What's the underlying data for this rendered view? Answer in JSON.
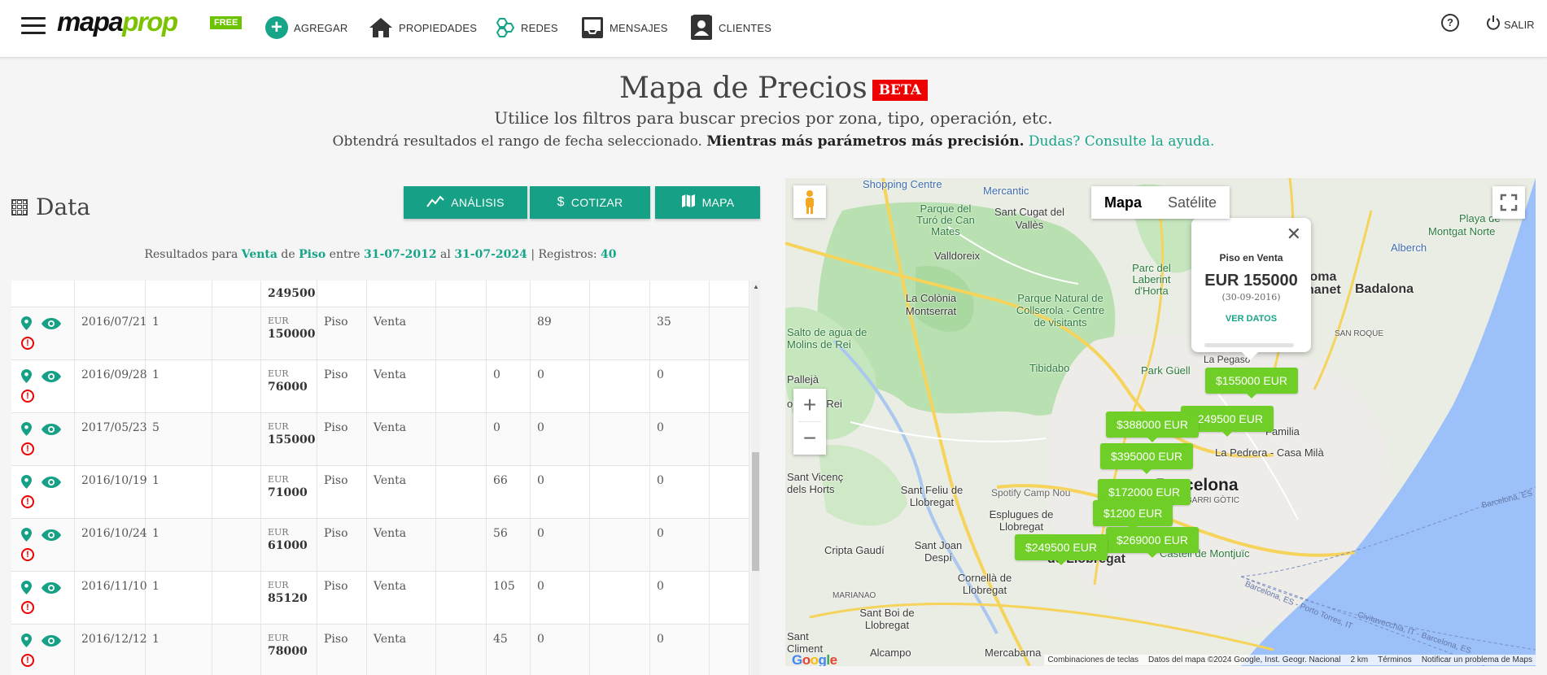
{
  "nav": {
    "logo_a": "mapa",
    "logo_b": "prop",
    "free": "FREE",
    "items": [
      {
        "label": "AGREGAR"
      },
      {
        "label": "PROPIEDADES"
      },
      {
        "label": "REDES"
      },
      {
        "label": "MENSAJES"
      },
      {
        "label": "CLIENTES"
      }
    ],
    "help": "?",
    "logout": "SALIR"
  },
  "header": {
    "title": "Mapa de Precios",
    "beta": "BETA",
    "subtitle": "Utilice los filtros para buscar precios por zona, tipo, operación, etc.",
    "line2_a": "Obtendrá resultados el rango de fecha seleccionado.",
    "line2_b": "Mientras más parámetros más precisión.",
    "line2_link": "Dudas? Consulte la ayuda."
  },
  "data_panel": {
    "title": "Data",
    "buttons": {
      "analisis": "ANÁLISIS",
      "cotizar": "COTIZAR",
      "mapa": "MAPA"
    },
    "results": {
      "prefix": "Resultados para",
      "operation": "Venta",
      "de": "de",
      "type": "Piso",
      "entre": "entre",
      "from": "31-07-2012",
      "al": "al",
      "to": "31-07-2024",
      "sep": "| Registros:",
      "count": "40"
    },
    "rows": [
      {
        "date": "",
        "qty": "",
        "cur": "",
        "amount": "249500",
        "type": "",
        "op": "",
        "c1": "",
        "c2": "",
        "c3": ""
      },
      {
        "date": "2016/07/21",
        "qty": "1",
        "cur": "EUR",
        "amount": "150000",
        "type": "Piso",
        "op": "Venta",
        "c1": "",
        "c2": "89",
        "c3": "35"
      },
      {
        "date": "2016/09/28",
        "qty": "1",
        "cur": "EUR",
        "amount": "76000",
        "type": "Piso",
        "op": "Venta",
        "c1": "0",
        "c2": "0",
        "c3": "0"
      },
      {
        "date": "2017/05/23",
        "qty": "5",
        "cur": "EUR",
        "amount": "155000",
        "type": "Piso",
        "op": "Venta",
        "c1": "0",
        "c2": "0",
        "c3": "0"
      },
      {
        "date": "2016/10/19",
        "qty": "1",
        "cur": "EUR",
        "amount": "71000",
        "type": "Piso",
        "op": "Venta",
        "c1": "66",
        "c2": "0",
        "c3": "0"
      },
      {
        "date": "2016/10/24",
        "qty": "1",
        "cur": "EUR",
        "amount": "61000",
        "type": "Piso",
        "op": "Venta",
        "c1": "56",
        "c2": "0",
        "c3": "0"
      },
      {
        "date": "2016/11/10",
        "qty": "1",
        "cur": "EUR",
        "amount": "85120",
        "type": "Piso",
        "op": "Venta",
        "c1": "105",
        "c2": "0",
        "c3": "0"
      },
      {
        "date": "2016/12/12",
        "qty": "1",
        "cur": "EUR",
        "amount": "78000",
        "type": "Piso",
        "op": "Venta",
        "c1": "45",
        "c2": "0",
        "c3": "0"
      }
    ]
  },
  "map": {
    "toggle": {
      "map": "Mapa",
      "satellite": "Satélite"
    },
    "zoom_in": "+",
    "zoom_out": "−",
    "info": {
      "title": "Piso en Venta",
      "price": "EUR 155000",
      "date": "(30-09-2016)",
      "link": "VER DATOS"
    },
    "price_tags": [
      {
        "label": "$155000 EUR"
      },
      {
        "label": "$249500 EUR"
      },
      {
        "label": "$388000 EUR"
      },
      {
        "label": "$395000 EUR"
      },
      {
        "label": "$172000 EUR"
      },
      {
        "label": "$1200 EUR"
      },
      {
        "label": "$269000 EUR"
      },
      {
        "label": "$249500 EUR"
      }
    ],
    "labels": {
      "barcelona": "Barcelona",
      "badalona": "Badalona",
      "sant_cugat": "Sant Cugat del Vallès",
      "valldoreix": "Valldoreix",
      "colonia": "La Colònia Montserrat",
      "collserola": "Parque Natural de Collserola - Centre de visitants",
      "parc_laberint": "Parc del Laberint d'Horta",
      "tibidabo": "Tibidabo",
      "park_guell": "Park Güell",
      "esplugues": "Esplugues de Llobregat",
      "sant_feliu": "Sant Feliu de Llobregat",
      "hospitalet": "L'Hospitalet de Llobregat",
      "cornella": "Cornellà de Llobregat",
      "sant_joan": "Sant Joan Despí",
      "sant_boi": "Sant Boi de Llobregat",
      "molins": "olins de Rei",
      "alcampo": "Alcampo",
      "cripta": "Cripta Gaudí",
      "spotify": "Spotify Camp Nou",
      "castell": "Castell de Montjuïc",
      "pedrera": "La Pedrera - Casa Milà",
      "badalona_ne": "loma nanet",
      "alberch": "Alberch",
      "montgat": "Montgat Norte",
      "playa": "Playa de",
      "mercantic": "Mercantic",
      "shopping": "Shopping Centre",
      "parque_turo": "Parque del Turó de Can Mates",
      "salto": "Salto de agua de Molins de Rei",
      "marianao": "MARIANAO",
      "barri_gotic": "BARRI GÒTIC",
      "sea1": "Barcelona, ES - Porto Torres, IT",
      "sea2": "Civitavecchia, IT - Barcelona, ES",
      "sea3": "Barcelona, ES",
      "sant_roque": "SAN ROQUE",
      "familia": "Familia",
      "la_pegaso": "La Pegaso",
      "sant_vicenc": "Sant Vicenç dels Horts",
      "pallej": "Pallejà",
      "sant_climent": "Sant Climent",
      "mercabarna": "Mercabarna"
    },
    "attribution": {
      "logo": "Google",
      "shortcuts": "Combinaciones de teclas",
      "data": "Datos del mapa ©2024 Google, Inst. Geogr. Nacional",
      "scale": "2 km",
      "terms": "Términos",
      "report": "Notificar un problema de Maps"
    }
  }
}
